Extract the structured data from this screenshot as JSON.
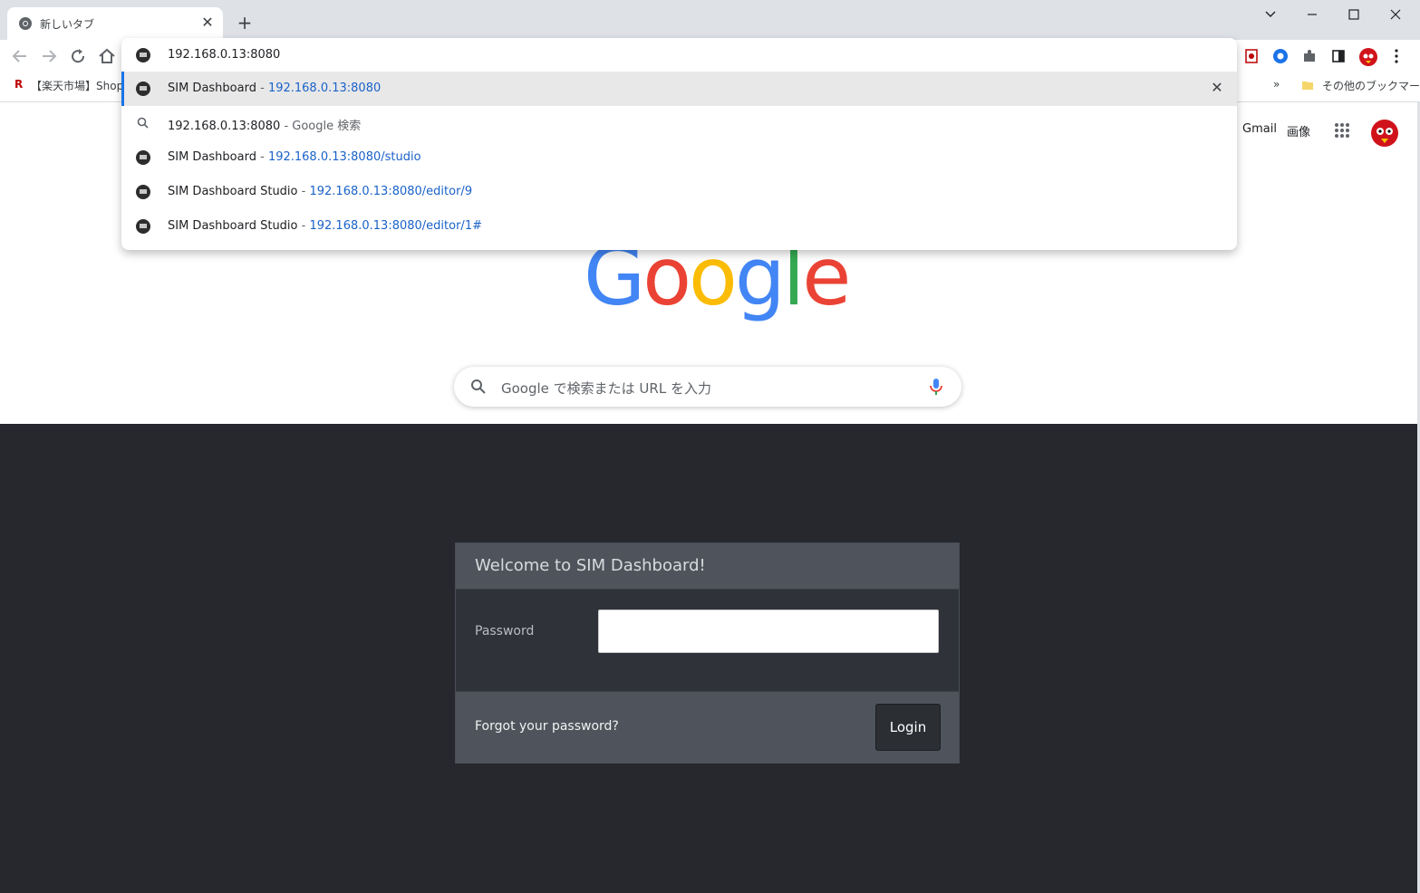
{
  "browser": {
    "tab_title": "新しいタブ",
    "new_tab_label": "+",
    "tab_close_glyph": "✕",
    "omnibox_text": "192.168.0.13:8080",
    "bookmarks": [
      {
        "label": "【楽天市場】Shoppi"
      }
    ],
    "bookmarks_overflow": "»",
    "other_bookmarks": "その他のブックマーク"
  },
  "omnibox_suggestions": [
    {
      "title": "SIM Dashboard",
      "sep": " - ",
      "url_bold": "192.168.0.13:8080",
      "url_rest": "",
      "icon": "site-favicon",
      "selected": true
    },
    {
      "title": "192.168.0.13:8080",
      "sep": " - ",
      "suffix": "Google 検索",
      "icon": "search-icon"
    },
    {
      "title": "SIM Dashboard",
      "sep": " - ",
      "url_bold": "192.168.0.13:8080",
      "url_rest": "/studio",
      "icon": "site-favicon"
    },
    {
      "title": "SIM Dashboard Studio",
      "sep": " - ",
      "url_bold": "192.168.0.13:8080",
      "url_rest": "/editor/9",
      "icon": "site-favicon"
    },
    {
      "title": "SIM Dashboard Studio",
      "sep": " - ",
      "url_bold": "192.168.0.13:8080",
      "url_rest": "/editor/1#",
      "icon": "site-favicon"
    }
  ],
  "google_page": {
    "links": {
      "gmail": "Gmail",
      "images": "画像"
    },
    "logo_letters": [
      "G",
      "o",
      "o",
      "g",
      "l",
      "e"
    ],
    "logo_colors": [
      "#4285F4",
      "#EA4335",
      "#FBBC05",
      "#4285F4",
      "#34A853",
      "#EA4335"
    ],
    "search_placeholder": "Google で検索または URL を入力"
  },
  "login": {
    "header": "Welcome to SIM Dashboard!",
    "password_label": "Password",
    "password_value": "",
    "forgot": "Forgot your password?",
    "login_button": "Login"
  }
}
